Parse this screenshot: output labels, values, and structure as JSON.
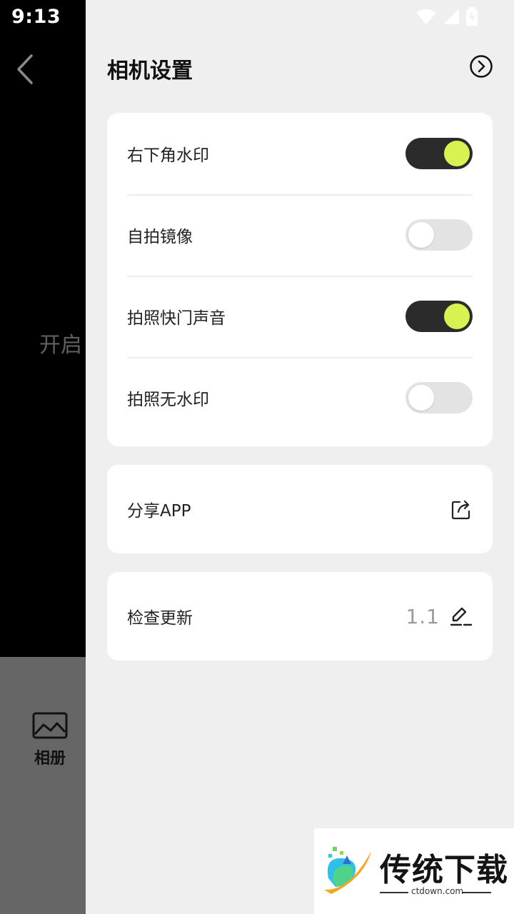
{
  "status_bar": {
    "time": "9:13"
  },
  "background": {
    "open_text": "开启",
    "album_label": "相册"
  },
  "header": {
    "title": "相机设置"
  },
  "settings": [
    {
      "label": "右下角水印",
      "enabled": true
    },
    {
      "label": "自拍镜像",
      "enabled": false
    },
    {
      "label": "拍照快门声音",
      "enabled": true
    },
    {
      "label": "拍照无水印",
      "enabled": false
    }
  ],
  "share": {
    "label": "分享APP"
  },
  "update": {
    "label": "检查更新",
    "version": "1.1"
  },
  "watermark": {
    "brand": "传统下载",
    "domain": "ctdown.com"
  },
  "colors": {
    "toggle_on_track": "#2b2b2b",
    "toggle_knob_on": "#d8f351",
    "panel_bg": "#efefef"
  }
}
